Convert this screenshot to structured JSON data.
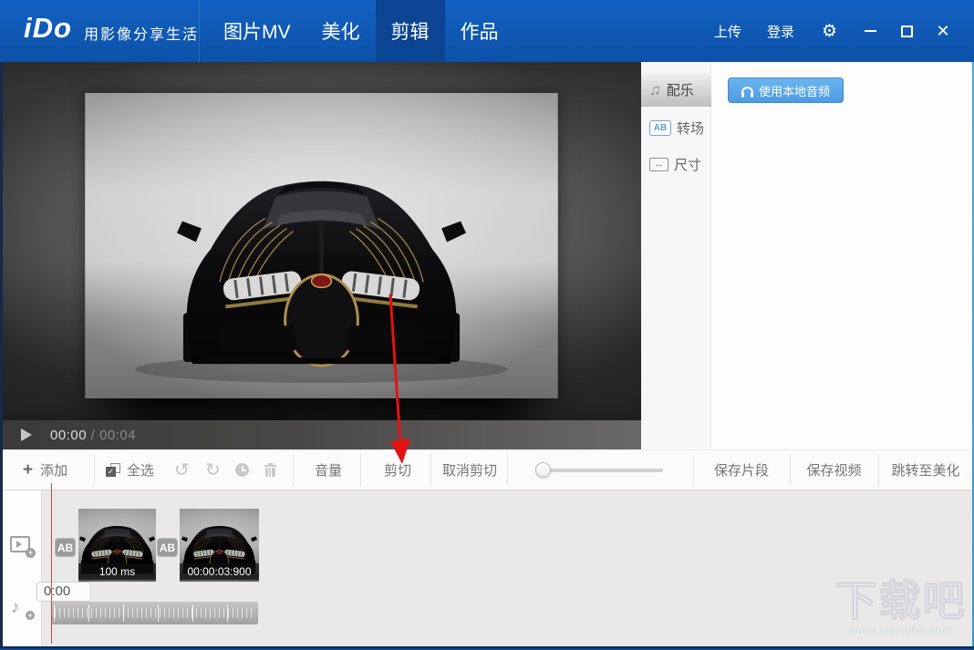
{
  "header": {
    "logo": "iDo",
    "tagline": "用影像分享生活",
    "tabs": [
      {
        "label": "图片MV",
        "active": false
      },
      {
        "label": "美化",
        "active": false
      },
      {
        "label": "剪辑",
        "active": true
      },
      {
        "label": "作品",
        "active": false
      }
    ],
    "upload": "上传",
    "login": "登录"
  },
  "preview": {
    "time_current": "00:00",
    "time_separator": " / ",
    "time_total": "00:04"
  },
  "sidebar": {
    "tabs": [
      {
        "label": "配乐",
        "active": true
      },
      {
        "label": "转场",
        "icon_text": "AB",
        "active": false
      },
      {
        "label": "尺寸",
        "active": false
      }
    ]
  },
  "audio_panel": {
    "local_audio_button": "使用本地音频"
  },
  "toolbar": {
    "add": "添加",
    "select_all": "全选",
    "volume": "音量",
    "cut": "剪切",
    "cancel_cut": "取消剪切",
    "save_clip": "保存片段",
    "save_video": "保存视频",
    "goto_beautify": "跳转至美化"
  },
  "timeline": {
    "ruler_start": "0:00",
    "clips": [
      {
        "transition_badge": "AB",
        "duration_label": "100 ms"
      },
      {
        "transition_badge": "AB",
        "duration_label": "00:00:03:900"
      }
    ]
  },
  "watermark": {
    "title": "下载吧",
    "url": "www.xiazaiba.com"
  },
  "icons": {
    "gear": "⚙",
    "close": "✕",
    "undo": "↺",
    "redo": "↻",
    "music_tab": "♫",
    "music_track": "♪",
    "resize_arrows": "↔",
    "plus": "+",
    "check": "✓"
  },
  "colors": {
    "header_blue": "#0f58b6",
    "header_active_tab": "#0a4492",
    "accent_button_blue": "#54a3e6",
    "arrow_red": "#e31212",
    "playhead_red": "#c64747"
  }
}
